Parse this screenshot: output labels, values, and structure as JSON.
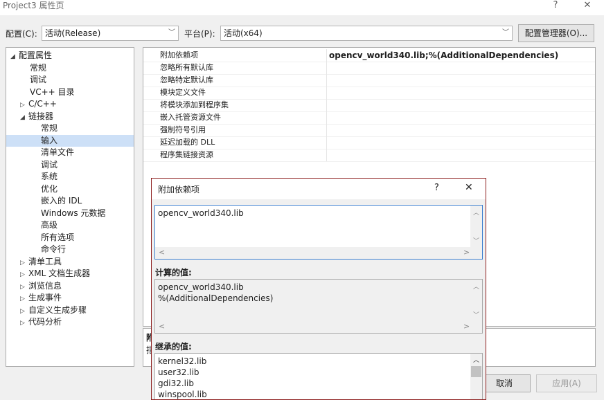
{
  "window": {
    "title": "Project3 属性页",
    "help": "?",
    "close": "✕"
  },
  "config": {
    "config_label": "配置(C):",
    "config_value": "活动(Release)",
    "platform_label": "平台(P):",
    "platform_value": "活动(x64)",
    "manager_button": "配置管理器(O)..."
  },
  "tree": {
    "items": [
      {
        "label": "配置属性",
        "arrow": "◢"
      },
      {
        "label": "常规"
      },
      {
        "label": "调试"
      },
      {
        "label": "VC++ 目录"
      },
      {
        "label": "C/C++",
        "arrow": "▷"
      },
      {
        "label": "链接器",
        "arrow": "◢"
      },
      {
        "label": "常规"
      },
      {
        "label": "输入"
      },
      {
        "label": "清单文件"
      },
      {
        "label": "调试"
      },
      {
        "label": "系统"
      },
      {
        "label": "优化"
      },
      {
        "label": "嵌入的 IDL"
      },
      {
        "label": "Windows 元数据"
      },
      {
        "label": "高级"
      },
      {
        "label": "所有选项"
      },
      {
        "label": "命令行"
      },
      {
        "label": "清单工具",
        "arrow": "▷"
      },
      {
        "label": "XML 文档生成器",
        "arrow": "▷"
      },
      {
        "label": "浏览信息",
        "arrow": "▷"
      },
      {
        "label": "生成事件",
        "arrow": "▷"
      },
      {
        "label": "自定义生成步骤",
        "arrow": "▷"
      },
      {
        "label": "代码分析",
        "arrow": "▷"
      }
    ]
  },
  "grid": {
    "rows": [
      {
        "name": "附加依赖项",
        "value": "opencv_world340.lib;%(AdditionalDependencies)"
      },
      {
        "name": "忽略所有默认库",
        "value": ""
      },
      {
        "name": "忽略特定默认库",
        "value": ""
      },
      {
        "name": "模块定义文件",
        "value": ""
      },
      {
        "name": "将模块添加到程序集",
        "value": ""
      },
      {
        "name": "嵌入托管资源文件",
        "value": ""
      },
      {
        "name": "强制符号引用",
        "value": ""
      },
      {
        "name": "延迟加载的 DLL",
        "value": ""
      },
      {
        "name": "程序集链接资源",
        "value": ""
      }
    ]
  },
  "description": {
    "line1": "附",
    "line2": "指"
  },
  "footer": {
    "cancel": "取消",
    "apply": "应用(A)"
  },
  "dialog": {
    "title": "附加依赖项",
    "help": "?",
    "close": "✕",
    "input_text": "opencv_world340.lib",
    "computed_label": "计算的值:",
    "computed_lines": [
      "opencv_world340.lib",
      "%(AdditionalDependencies)"
    ],
    "inherited_label": "继承的值:",
    "inherited_lines": [
      "kernel32.lib",
      "user32.lib",
      "gdi32.lib",
      "winspool.lib"
    ]
  }
}
